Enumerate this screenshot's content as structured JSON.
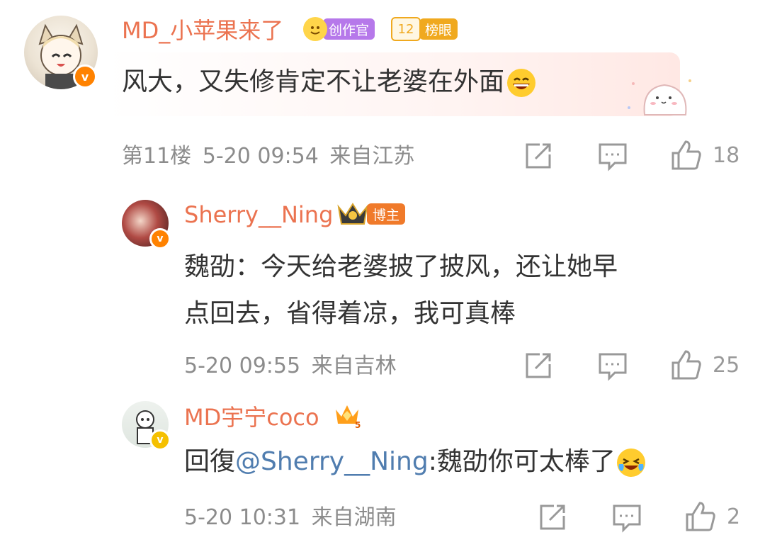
{
  "comments": [
    {
      "user": "MD_小苹果来了",
      "badges": [
        {
          "label": "创作官",
          "color": "#b678ea"
        },
        {
          "label": "榜眼",
          "color": "#f0a91f",
          "level": "12"
        }
      ],
      "text": "风大，又失修肯定不让老婆在外面",
      "emoji": "grinning-face",
      "floor": "第11楼",
      "time": "5-20 09:54",
      "location": "来自江苏",
      "likes": "18"
    }
  ],
  "replies": [
    {
      "user": "Sherry__Ning",
      "badge": "博主",
      "text_line1": "魏劭：今天给老婆披了披风，还让她早",
      "text_line2": "点回去，省得着凉，我可真棒",
      "time": "5-20 09:55",
      "location": "来自吉林",
      "likes": "25"
    },
    {
      "user": "MD宇宁coco",
      "reply_prefix": "回復",
      "mention": "@Sherry__Ning",
      "text": ":魏劭你可太棒了",
      "emoji": "laughing-crying-face",
      "time": "5-20 10:31",
      "location": "来自湖南",
      "likes": "2"
    }
  ],
  "colors": {
    "username": "#eb7350",
    "mention": "#507daf",
    "verified": "#ff8200",
    "meta": "#8c8c8c"
  }
}
